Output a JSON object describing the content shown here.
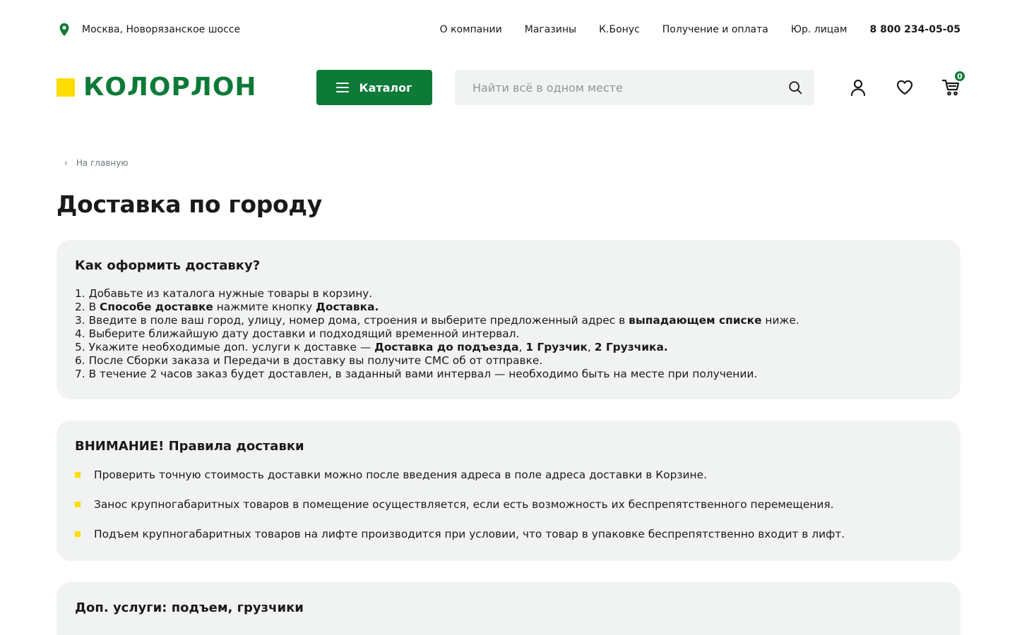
{
  "topbar": {
    "location": "Москва, Новорязанское шоссе",
    "nav": [
      "О компании",
      "Магазины",
      "К.Бонус",
      "Получение и оплата",
      "Юр. лицам"
    ],
    "phone": "8 800 234-05-05"
  },
  "header": {
    "logo_text": "КОЛОРЛОН",
    "catalog_label": "Каталог",
    "search_placeholder": "Найти всё в одном месте",
    "cart_count": "0"
  },
  "breadcrumb": {
    "back_label": "На главную"
  },
  "page": {
    "title": "Доставка по городу"
  },
  "how_to": {
    "title": "Как оформить доставку?",
    "steps": [
      [
        {
          "t": "1. Добавьте из каталога нужные товары в корзину."
        }
      ],
      [
        {
          "t": "2. В "
        },
        {
          "t": "Способе доставке",
          "b": true
        },
        {
          "t": " нажмите кнопку "
        },
        {
          "t": "Доставка.",
          "b": true
        }
      ],
      [
        {
          "t": "3. Введите в поле ваш город, улицу, номер дома, строения и выберите предложенный адрес в "
        },
        {
          "t": "выпадающем списке",
          "b": true
        },
        {
          "t": " ниже."
        }
      ],
      [
        {
          "t": "4. Выберите ближайшую дату доставки и подходящий временной интервал."
        }
      ],
      [
        {
          "t": "5. Укажите необходимые доп. услуги к доставке — "
        },
        {
          "t": "Доставка до подъезда",
          "b": true
        },
        {
          "t": ", "
        },
        {
          "t": "1 Грузчик",
          "b": true
        },
        {
          "t": ", "
        },
        {
          "t": "2 Грузчика.",
          "b": true
        }
      ],
      [
        {
          "t": "6. После Сборки заказа и Передачи в доставку вы получите СМС об от отправке."
        }
      ],
      [
        {
          "t": "7. В течение 2 часов заказ будет доставлен, в заданный вами интервал — необходимо быть на месте при получении."
        }
      ]
    ]
  },
  "rules": {
    "title": "ВНИМАНИЕ! Правила доставки",
    "items": [
      "Проверить точную стоимость доставки можно после введения адреса в поле адреса доставки в Корзине.",
      "Занос крупногабаритных товаров в помещение осуществляется, если есть возможность их беспрепятственного перемещения.",
      "Подъем крупногабаритных товаров на лифте производится при условии, что товар в упаковке беспрепятственно входит в лифт."
    ]
  },
  "services": {
    "title": "Доп. услуги: подъем, грузчики"
  },
  "colors": {
    "brand_green": "#0e7a38",
    "brand_yellow": "#ffdd00",
    "card_bg": "#f1f2f2"
  }
}
